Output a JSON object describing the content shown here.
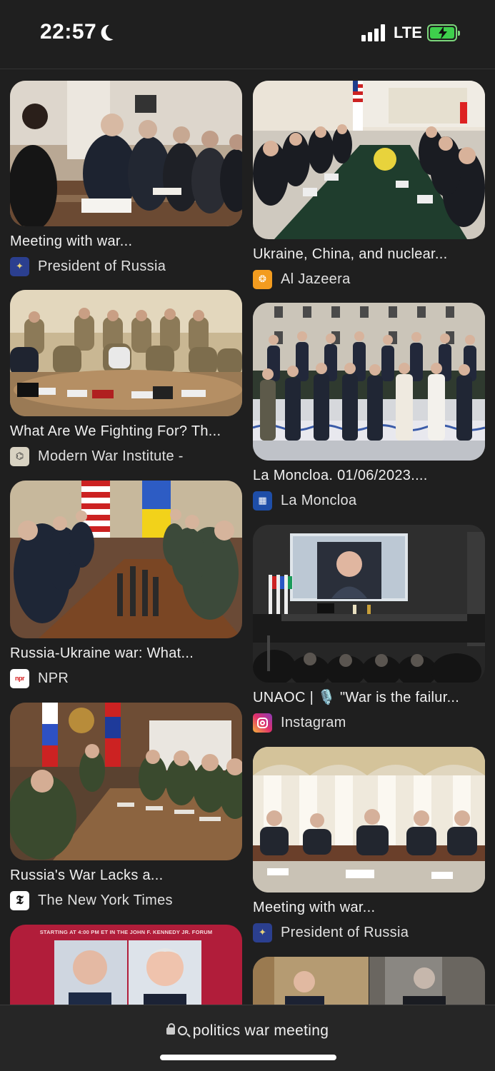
{
  "status": {
    "time": "22:57",
    "network": "LTE"
  },
  "results": [
    {
      "caption": "Meeting with war...",
      "source": "President of Russia",
      "favicon_icon": "russia-emblem-icon"
    },
    {
      "caption": "Ukraine, China, and nuclear...",
      "source": "Al Jazeera",
      "favicon_icon": "al-jazeera-logo-icon"
    },
    {
      "caption": "What Are We Fighting For? Th...",
      "source": "Modern War Institute -",
      "favicon_icon": "mwi-logo-icon"
    },
    {
      "caption": "La Moncloa. 01/06/2023....",
      "source": "La Moncloa",
      "favicon_icon": "la-moncloa-logo-icon"
    },
    {
      "caption": "Russia-Ukraine war: What...",
      "source": "NPR",
      "favicon_icon": "npr-logo-icon"
    },
    {
      "caption": "UNAOC | 🎙️ \"War is the failur...",
      "source": "Instagram",
      "favicon_icon": "instagram-logo-icon"
    },
    {
      "caption": "Russia's War Lacks a...",
      "source": "The New York Times",
      "favicon_icon": "nyt-logo-icon"
    },
    {
      "caption": "Meeting with war...",
      "source": "President of Russia",
      "favicon_icon": "russia-emblem-icon"
    }
  ],
  "partial_thumbs": [
    {
      "banner": "STARTING AT 4:00 PM ET IN THE JOHN F. KENNEDY JR. FORUM"
    }
  ],
  "address_bar": {
    "query": "politics war meeting"
  },
  "colors": {
    "background": "#1f1f1f",
    "battery": "#3ecf4c",
    "al_jazeera": "#f39c1f",
    "instagram": "#e1306c"
  }
}
